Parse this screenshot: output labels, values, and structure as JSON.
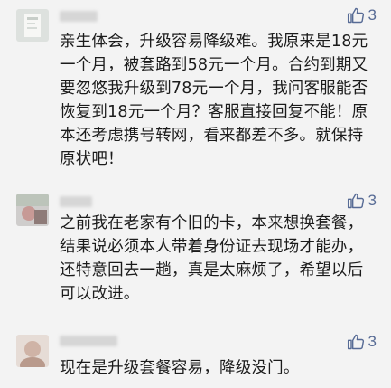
{
  "comments": [
    {
      "likes": "3",
      "content": "亲生体会，升级容易降级难。我原来是18元一个月，被套路到58元一个月。合约到期又要忽悠我升级到78元一个月，我问客服能否恢复到18元一个月？客服直接回复不能！原本还考虑携号转网，看来都差不多。就保持原状吧！"
    },
    {
      "likes": "3",
      "content": "之前我在老家有个旧的卡，本来想换套餐，结果说必须本人带着身份证去现场才能办，还特意回去一趟，真是太麻烦了，希望以后可以改进。"
    },
    {
      "likes": "3",
      "content": "现在是升级套餐容易，降级没门。"
    }
  ],
  "colors": {
    "background": "#f3f3f3",
    "text": "#1b1b1b",
    "accent": "#576b95"
  },
  "icons": {
    "like": "thumbs-up-icon"
  }
}
